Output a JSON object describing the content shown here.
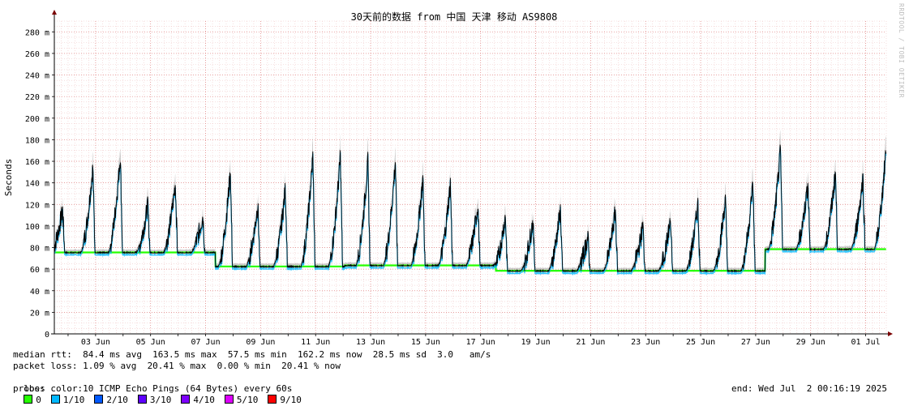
{
  "rrd_credit": "RRDTOOL / TOBI OETIKER",
  "stats": {
    "median_rtt": "median rtt:  84.4 ms avg  163.5 ms max  57.5 ms min  162.2 ms now  28.5 ms sd  3.0   am/s",
    "packet_loss": "packet loss: 1.09 % avg  20.41 % max  0.00 % min  20.41 % now",
    "loss_color_label": "loss color:",
    "loss_colors": [
      {
        "label": "0",
        "color": "#26ff00"
      },
      {
        "label": "1/10",
        "color": "#00b8ff"
      },
      {
        "label": "2/10",
        "color": "#0059ff"
      },
      {
        "label": "3/10",
        "color": "#5e00ff"
      },
      {
        "label": "4/10",
        "color": "#7e00ff"
      },
      {
        "label": "5/10",
        "color": "#dd00ff"
      },
      {
        "label": "9/10",
        "color": "#ff0000"
      }
    ],
    "probe": "probe:       10 ICMP Echo Pings (64 Bytes) every 60s",
    "end": "end: Wed Jul  2 00:16:19 2025"
  },
  "chart_data": {
    "type": "line",
    "title": "30天前的数据 from 中国 天津 移动 AS9808",
    "ylabel": "Seconds",
    "xlabel": "",
    "ylim": [
      0,
      290
    ],
    "y_unit_suffix": " m",
    "yticks": [
      0,
      20,
      40,
      60,
      80,
      100,
      120,
      140,
      160,
      180,
      200,
      220,
      240,
      260,
      280
    ],
    "xlim": [
      1.5,
      31.75
    ],
    "xticks": [
      {
        "x": 3,
        "label": "03 Jun"
      },
      {
        "x": 5,
        "label": "05 Jun"
      },
      {
        "x": 7,
        "label": "07 Jun"
      },
      {
        "x": 9,
        "label": "09 Jun"
      },
      {
        "x": 11,
        "label": "11 Jun"
      },
      {
        "x": 13,
        "label": "13 Jun"
      },
      {
        "x": 15,
        "label": "15 Jun"
      },
      {
        "x": 17,
        "label": "17 Jun"
      },
      {
        "x": 19,
        "label": "19 Jun"
      },
      {
        "x": 21,
        "label": "21 Jun"
      },
      {
        "x": 23,
        "label": "23 Jun"
      },
      {
        "x": 25,
        "label": "25 Jun"
      },
      {
        "x": 27,
        "label": "27 Jun"
      },
      {
        "x": 29,
        "label": "29 Jun"
      },
      {
        "x": 31,
        "label": "01 Jul"
      }
    ],
    "grid": true,
    "series": [
      {
        "line_color": "#000000",
        "band_color": "#8c8c8c",
        "baseline_color": "#26ff00",
        "edge_color": "#00b8ff",
        "daily_base_ms": [
          [
            1.5,
            75
          ],
          [
            7.3,
            75
          ],
          [
            7.35,
            62
          ],
          [
            12.0,
            62
          ],
          [
            12.05,
            63
          ],
          [
            17.5,
            62
          ],
          [
            17.55,
            58
          ],
          [
            27.3,
            58
          ],
          [
            27.35,
            78
          ],
          [
            31.75,
            80
          ]
        ],
        "daily_peak_ms": [
          {
            "day": 1.8,
            "value": 115
          },
          {
            "day": 2.9,
            "value": 155
          },
          {
            "day": 3.9,
            "value": 165
          },
          {
            "day": 4.9,
            "value": 120
          },
          {
            "day": 5.9,
            "value": 140
          },
          {
            "day": 6.9,
            "value": 110
          },
          {
            "day": 7.9,
            "value": 150
          },
          {
            "day": 8.9,
            "value": 120
          },
          {
            "day": 9.9,
            "value": 135
          },
          {
            "day": 10.9,
            "value": 165
          },
          {
            "day": 11.9,
            "value": 165
          },
          {
            "day": 12.9,
            "value": 160
          },
          {
            "day": 13.9,
            "value": 160
          },
          {
            "day": 14.9,
            "value": 145
          },
          {
            "day": 15.9,
            "value": 140
          },
          {
            "day": 16.9,
            "value": 120
          },
          {
            "day": 17.9,
            "value": 110
          },
          {
            "day": 18.9,
            "value": 105
          },
          {
            "day": 19.9,
            "value": 115
          },
          {
            "day": 20.9,
            "value": 90
          },
          {
            "day": 21.9,
            "value": 115
          },
          {
            "day": 22.9,
            "value": 100
          },
          {
            "day": 23.9,
            "value": 105
          },
          {
            "day": 24.9,
            "value": 120
          },
          {
            "day": 25.9,
            "value": 125
          },
          {
            "day": 26.9,
            "value": 140
          },
          {
            "day": 27.9,
            "value": 170
          },
          {
            "day": 28.9,
            "value": 140
          },
          {
            "day": 29.9,
            "value": 150
          },
          {
            "day": 30.9,
            "value": 145
          },
          {
            "day": 31.75,
            "value": 175
          }
        ],
        "peak_width_days": 0.45,
        "last_value_ms": 162.2
      }
    ]
  }
}
